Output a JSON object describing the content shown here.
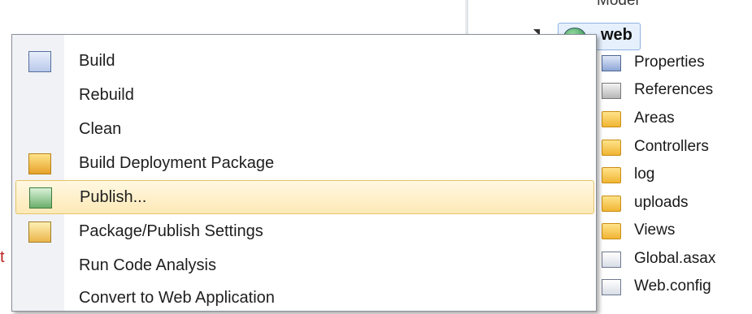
{
  "solution_explorer": {
    "model_label": "Model",
    "project_label": "web",
    "items": [
      {
        "label": "Properties",
        "icon": "properties-icon"
      },
      {
        "label": "References",
        "icon": "references-icon"
      },
      {
        "label": "Areas",
        "icon": "folder-icon"
      },
      {
        "label": "Controllers",
        "icon": "folder-icon"
      },
      {
        "label": "log",
        "icon": "folder-icon"
      },
      {
        "label": "uploads",
        "icon": "folder-icon"
      },
      {
        "label": "Views",
        "icon": "folder-icon"
      },
      {
        "label": "Global.asax",
        "icon": "asax-file-icon"
      },
      {
        "label": "Web.config",
        "icon": "config-file-icon"
      }
    ]
  },
  "context_menu": {
    "items": [
      {
        "label": "Build",
        "icon": "build-icon"
      },
      {
        "label": "Rebuild",
        "icon": ""
      },
      {
        "label": "Clean",
        "icon": ""
      },
      {
        "label": "Build Deployment Package",
        "icon": "deployment-package-icon"
      },
      {
        "label": "Publish...",
        "icon": "publish-icon",
        "selected": true
      },
      {
        "label": "Package/Publish Settings",
        "icon": "package-settings-icon"
      },
      {
        "label": "Run Code Analysis",
        "icon": ""
      },
      {
        "label": "Convert to Web Application",
        "icon": ""
      }
    ]
  },
  "background_fragment": "t"
}
